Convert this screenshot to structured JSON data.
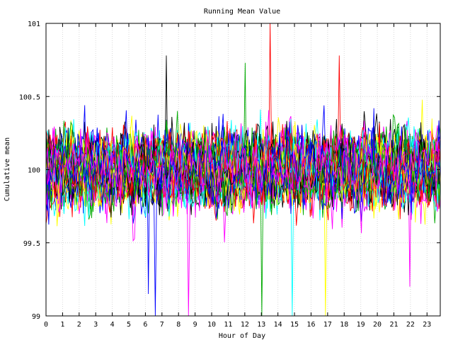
{
  "chart_data": {
    "type": "line",
    "title": "Running Mean Value",
    "xlabel": "Hour of Day",
    "ylabel": "Cumulative mean",
    "xlim": [
      0,
      23.8
    ],
    "ylim": [
      99,
      101
    ],
    "xticks": [
      "0",
      "1",
      "2",
      "3",
      "4",
      "5",
      "6",
      "7",
      "8",
      "9",
      "10",
      "11",
      "12",
      "13",
      "14",
      "15",
      "16",
      "17",
      "18",
      "19",
      "20",
      "21",
      "22",
      "23"
    ],
    "yticks": [
      "99",
      "99.5",
      "100",
      "100.5",
      "101"
    ],
    "grid": true,
    "legend": "none",
    "series_count": 60,
    "points_per_series": 286,
    "center": 100.0,
    "typical_band": [
      99.6,
      100.4
    ],
    "palette": [
      "#ff0000",
      "#00aa00",
      "#0000ff",
      "#ff00ff",
      "#00ffff",
      "#ffff00",
      "#000000"
    ],
    "notable_extremes": [
      {
        "x": 13.5,
        "y": 101.0
      },
      {
        "x": 13.0,
        "y": 99.0
      },
      {
        "x": 6.6,
        "y": 99.0
      },
      {
        "x": 8.6,
        "y": 99.0
      },
      {
        "x": 14.9,
        "y": 99.0
      },
      {
        "x": 16.9,
        "y": 99.0
      },
      {
        "x": 7.3,
        "y": 100.78
      },
      {
        "x": 17.7,
        "y": 100.78
      },
      {
        "x": 12.0,
        "y": 100.73
      },
      {
        "x": 6.2,
        "y": 99.15
      },
      {
        "x": 22.0,
        "y": 99.2
      }
    ]
  }
}
